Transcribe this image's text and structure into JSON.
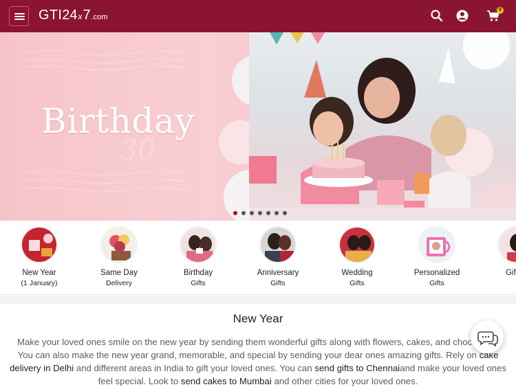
{
  "header": {
    "logo": {
      "gti": "GTI",
      "num1": "24",
      "x": "x",
      "num2": "7",
      "domain": ".com"
    },
    "cart_count": "0",
    "icons": [
      "menu-icon",
      "search-icon",
      "user-icon",
      "cart-icon"
    ],
    "colors": {
      "header_bg": "#8c1433",
      "badge": "#f4c20d"
    }
  },
  "banner": {
    "title": "Birthday",
    "slides_total": 7,
    "active_slide": 1
  },
  "categories": [
    {
      "label": "New Year",
      "sub": "(1 January)"
    },
    {
      "label": "Same Day",
      "sub": "Delivery"
    },
    {
      "label": "Birthday",
      "sub": "Gifts"
    },
    {
      "label": "Anniversary",
      "sub": "Gifts"
    },
    {
      "label": "Wedding",
      "sub": "Gifts"
    },
    {
      "label": "Personalized",
      "sub": "Gifts"
    },
    {
      "label": "Gifts f",
      "sub": ""
    }
  ],
  "section": {
    "title": "New Year",
    "p1": "Make your loved ones smile on the new year by sending them wonderful gifts along with flowers, cakes, and chocolates. You can also make the new year grand, memorable, and special by sending your dear ones amazing gifts. Rely on ",
    "link1": "cake delivery in Delhi",
    "p2": " and different areas in India to gift your loved ones. You can ",
    "link2": "send gifts to Chennai",
    "p3": "and make your loved ones feel special. Look to ",
    "link3": "send cakes to Mumbai",
    "p4": " and other cities for your loved ones."
  }
}
